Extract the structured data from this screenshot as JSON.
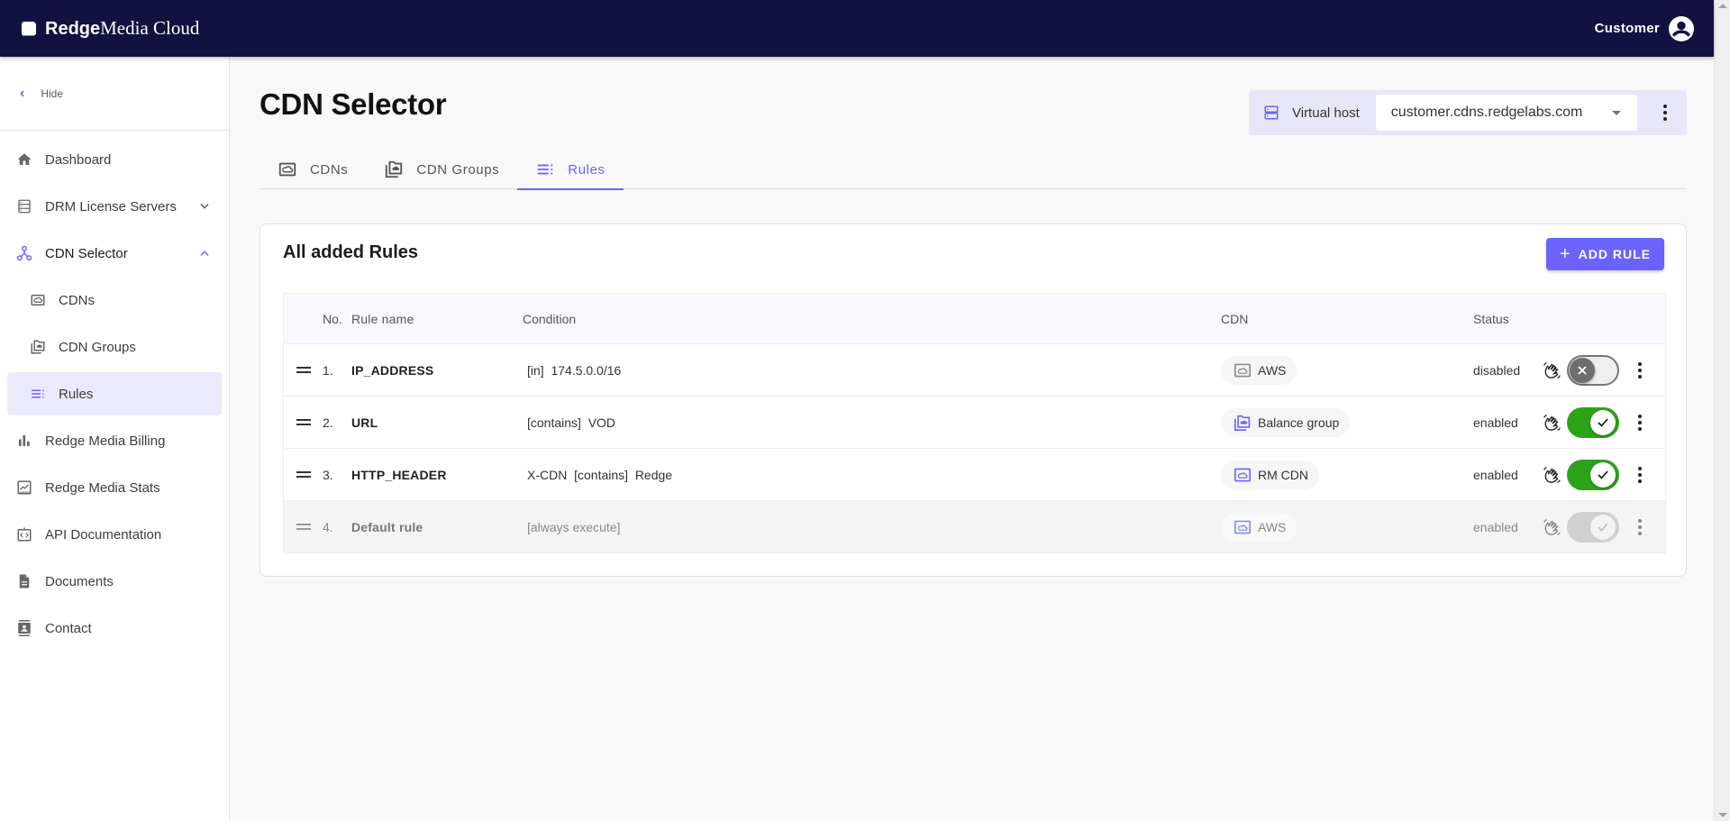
{
  "topbar": {
    "brand_bold": "Redge",
    "brand_rest": "Media Cloud",
    "user_label": "Customer"
  },
  "sidebar": {
    "hide_label": "Hide",
    "items": [
      {
        "label": "Dashboard",
        "icon": "home-icon"
      },
      {
        "label": "DRM License Servers",
        "icon": "server-list-icon",
        "expandable": true,
        "expanded": false
      },
      {
        "label": "CDN Selector",
        "icon": "hub-icon",
        "expandable": true,
        "expanded": true
      },
      {
        "label": "CDNs",
        "icon": "cloud-box-icon",
        "sub": true
      },
      {
        "label": "CDN Groups",
        "icon": "cloud-folder-icon",
        "sub": true
      },
      {
        "label": "Rules",
        "icon": "rules-list-icon",
        "sub": true,
        "selected": true
      },
      {
        "label": "Redge Media Billing",
        "icon": "bar-chart-icon"
      },
      {
        "label": "Redge Media Stats",
        "icon": "stats-chart-icon"
      },
      {
        "label": "API Documentation",
        "icon": "api-code-icon"
      },
      {
        "label": "Documents",
        "icon": "document-icon"
      },
      {
        "label": "Contact",
        "icon": "contact-card-icon"
      }
    ]
  },
  "main": {
    "title": "CDN Selector",
    "virtual_host": {
      "label": "Virtual host",
      "value": "customer.cdns.redgelabs.com"
    },
    "tabs": [
      {
        "label": "CDNs",
        "active": false
      },
      {
        "label": "CDN Groups",
        "active": false
      },
      {
        "label": "Rules",
        "active": true
      }
    ],
    "card": {
      "title": "All added Rules",
      "add_button": "ADD RULE",
      "columns": {
        "no": "No.",
        "name": "Rule name",
        "condition": "Condition",
        "cdn": "CDN",
        "status": "Status"
      },
      "rows": [
        {
          "no": "1.",
          "name": "IP_ADDRESS",
          "condition": "[in]  174.5.0.0/16",
          "cdn": "AWS",
          "cdn_type": "cdn",
          "status": "disabled",
          "enabled": false,
          "locked": false
        },
        {
          "no": "2.",
          "name": "URL",
          "condition": "[contains]  VOD",
          "cdn": "Balance group",
          "cdn_type": "group",
          "status": "enabled",
          "enabled": true,
          "locked": false
        },
        {
          "no": "3.",
          "name": "HTTP_HEADER",
          "condition": "X-CDN  [contains]  Redge",
          "cdn": "RM CDN",
          "cdn_type": "cdn",
          "status": "enabled",
          "enabled": true,
          "locked": false
        },
        {
          "no": "4.",
          "name": "Default rule",
          "condition": "[always execute]",
          "cdn": "AWS",
          "cdn_type": "cdn",
          "status": "enabled",
          "enabled": true,
          "locked": true
        }
      ]
    }
  },
  "colors": {
    "topbar_bg": "#121240",
    "accent": "#6c63ff",
    "toggle_on": "#2ea31a",
    "selected_nav_bg": "#ebeafc"
  }
}
